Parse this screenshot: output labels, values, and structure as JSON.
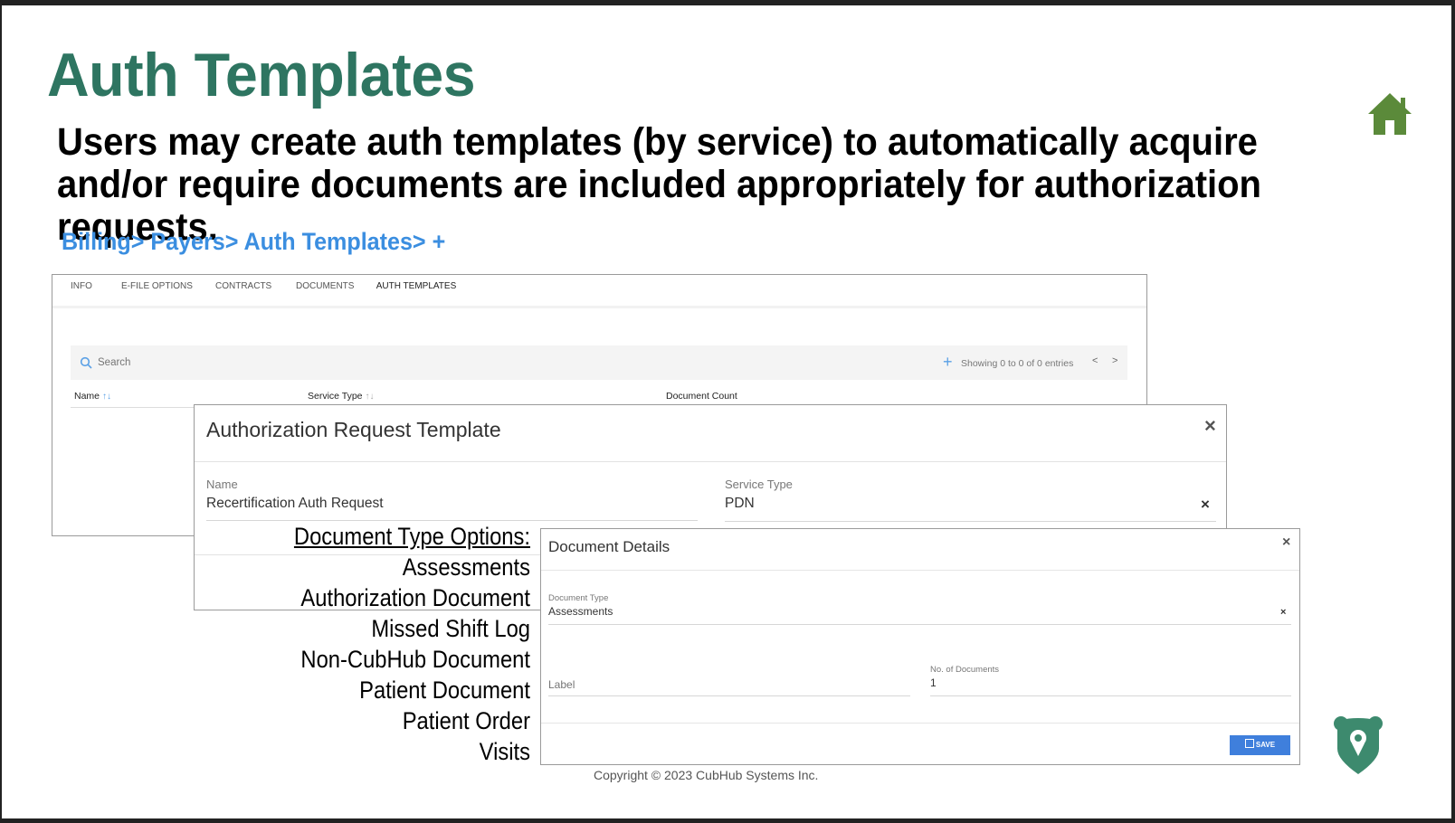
{
  "slide": {
    "title": "Auth Templates",
    "subtitle": "Users may create auth templates (by service) to automatically acquire and/or require documents are included appropriately for authorization requests.",
    "breadcrumb": "Billing> Payers> Auth Templates> +",
    "copyright": "Copyright © 2023 CubHub Systems Inc.",
    "colors": {
      "title": "#2e7561",
      "breadcrumb": "#3b8ee0",
      "home_icon": "#5b8a3a",
      "logo": "#3d8a6e",
      "save_button": "#3f7fdc"
    }
  },
  "payer_window": {
    "tabs": [
      {
        "label": "INFO",
        "active": false
      },
      {
        "label": "E-FILE OPTIONS",
        "active": false
      },
      {
        "label": "CONTRACTS",
        "active": false
      },
      {
        "label": "DOCUMENTS",
        "active": false
      },
      {
        "label": "AUTH TEMPLATES",
        "active": true
      }
    ],
    "search": {
      "placeholder": "Search"
    },
    "pagination": {
      "status": "Showing 0 to 0 of 0 entries",
      "prev": "<",
      "next": ">"
    },
    "add_icon": "plus-icon",
    "columns": [
      {
        "label": "Name",
        "sort": "↑↓"
      },
      {
        "label": "Service Type",
        "sort": "↑↓"
      },
      {
        "label": "Document Count",
        "sort": ""
      }
    ]
  },
  "auth_modal": {
    "title": "Authorization Request Template",
    "name_label": "Name",
    "name_value": "Recertification Auth Request",
    "service_type_label": "Service Type",
    "service_type_value": "PDN",
    "close": "×",
    "clear": "×"
  },
  "document_type_options": {
    "heading": "Document Type Options:",
    "items": [
      "Assessments",
      "Authorization Document",
      "Missed Shift Log",
      "Non-CubHub Document",
      "Patient Document",
      "Patient Order",
      "Visits"
    ]
  },
  "doc_modal": {
    "title": "Document Details",
    "close": "×",
    "document_type_label": "Document Type",
    "document_type_value": "Assessments",
    "clear": "×",
    "label_placeholder": "Label",
    "num_docs_label": "No. of Documents",
    "num_docs_value": "1",
    "save_label": "SAVE"
  }
}
